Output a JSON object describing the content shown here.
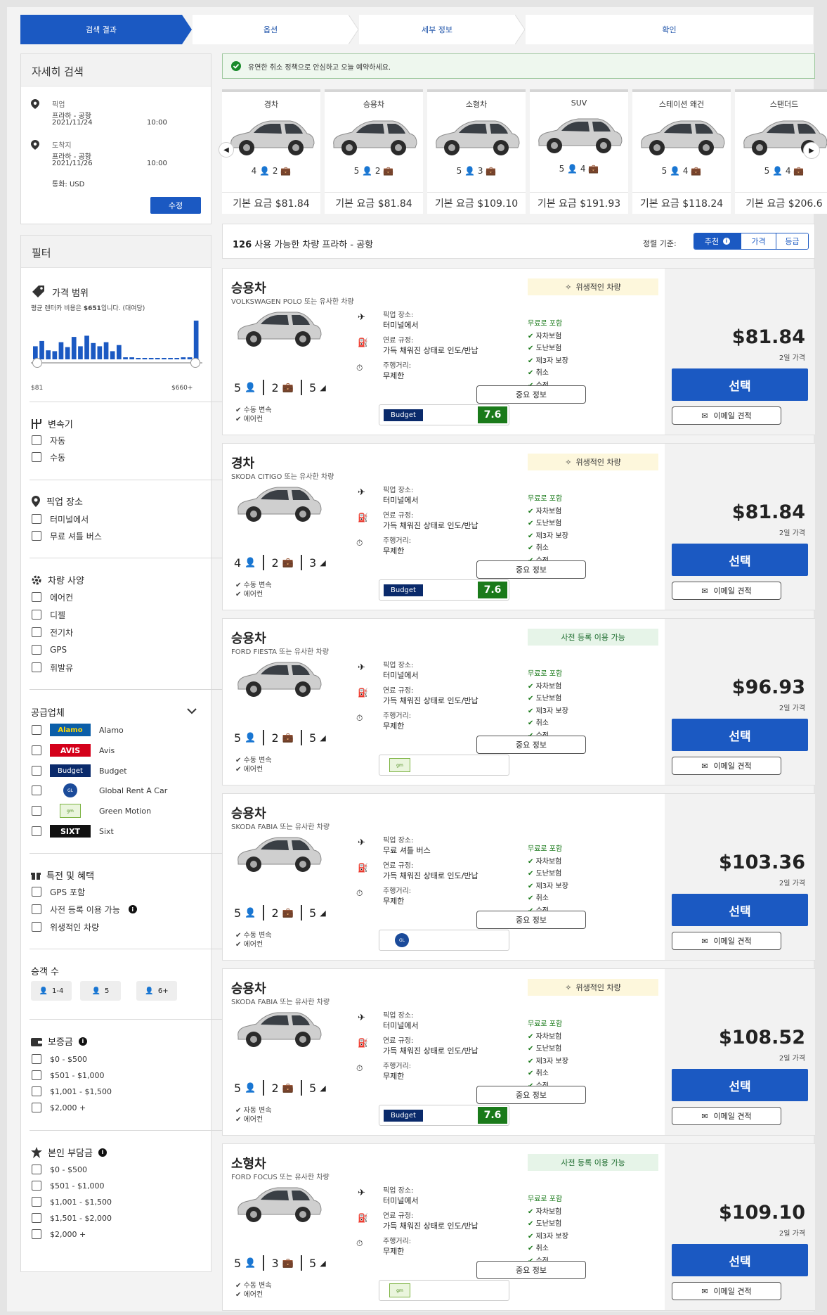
{
  "steps": [
    "검색 결과",
    "옵션",
    "세부 정보",
    "확인"
  ],
  "search": {
    "title": "자세히 검색",
    "pickup_label": "픽업",
    "pickup_place": "프라하 - 공항",
    "pickup_date": "2021/11/24",
    "pickup_time": "10:00",
    "dropoff_label": "도착지",
    "dropoff_place": "프라하 - 공항",
    "dropoff_date": "2021/11/26",
    "dropoff_time": "10:00",
    "currency": "통화: USD",
    "edit_label": "수정"
  },
  "filters": {
    "title": "필터",
    "price": {
      "title": "가격 범위",
      "note_prefix": "평균 렌터카 비용은 ",
      "note_value": "$651",
      "note_suffix": "입니다. (대여당)",
      "min_label": "$81",
      "max_label": "$660+",
      "histogram": [
        0.32,
        0.45,
        0.22,
        0.2,
        0.42,
        0.3,
        0.55,
        0.32,
        0.58,
        0.4,
        0.32,
        0.42,
        0.2,
        0.35,
        0.05,
        0.05,
        0.02,
        0.02,
        0.02,
        0.02,
        0.02,
        0.02,
        0.02,
        0.05,
        0.05,
        0.95
      ]
    },
    "transmission": {
      "title": "변속기",
      "options": [
        "자동",
        "수동"
      ]
    },
    "pickup": {
      "title": "픽업 장소",
      "options": [
        "터미널에서",
        "무료 셔틀 버스"
      ]
    },
    "specs": {
      "title": "차량 사양",
      "options": [
        "에어컨",
        "디젤",
        "전기차",
        "GPS",
        "휘발유"
      ]
    },
    "suppliers": {
      "title": "공급업체",
      "options": [
        "Alamo",
        "Avis",
        "Budget",
        "Global Rent A Car",
        "Green Motion",
        "Sixt"
      ]
    },
    "deals": {
      "title": "특전 및 혜택",
      "options": [
        "GPS 포함",
        "사전 등록 이용 가능",
        "위생적인 차량"
      ]
    },
    "passengers": {
      "title": "승객 수",
      "options": [
        "1-4",
        "5",
        "6+"
      ]
    },
    "deposit": {
      "title": "보증금",
      "options": [
        "$0 - $500",
        "$501 - $1,000",
        "$1,001 - $1,500",
        "$2,000 +"
      ]
    },
    "excess": {
      "title": "본인 부담금",
      "options": [
        "$0 - $500",
        "$501 - $1,000",
        "$1,001 - $1,500",
        "$1,501 - $2,000",
        "$2,000 +"
      ]
    }
  },
  "banner": "유연한 취소 정책으로 안심하고 오늘 예약하세요.",
  "categories": [
    {
      "name": "경차",
      "seats": "4",
      "bags": "2",
      "price": "기본 요금 $81.84"
    },
    {
      "name": "승용차",
      "seats": "5",
      "bags": "2",
      "price": "기본 요금 $81.84"
    },
    {
      "name": "소형차",
      "seats": "5",
      "bags": "3",
      "price": "기본 요금 $109.10"
    },
    {
      "name": "SUV",
      "seats": "5",
      "bags": "4",
      "price": "기본 요금 $191.93"
    },
    {
      "name": "스테이션 왜건",
      "seats": "5",
      "bags": "4",
      "price": "기본 요금 $118.24"
    },
    {
      "name": "스탠더드",
      "seats": "5",
      "bags": "4",
      "price": "기본 요금 $206.6"
    }
  ],
  "results_bar": {
    "count": "126",
    "text": " 사용 가능한 차량 ",
    "location": "프라하 - 공항",
    "sort_label": "정렬 기준:",
    "sort_options": [
      "추천",
      "가격",
      "등급"
    ]
  },
  "labels": {
    "pickup_place": "픽업 장소:",
    "fuel": "연료 규정:",
    "fuel_value": "가득 채워진 상태로 인도/반납",
    "mileage": "주행거리:",
    "mileage_value": "무제한",
    "included": "무료로 포함",
    "included_items": [
      "자차보험",
      "도난보험",
      "제3자 보장",
      "취소",
      "수정"
    ],
    "days": "2일 가격",
    "select": "선택",
    "details": "중요 정보",
    "email": "이메일 견적",
    "aircon": "에어컨"
  },
  "results": [
    {
      "category": "승용차",
      "model": "VOLKSWAGEN POLO 또는 유사한 차량",
      "seats": "5",
      "bags": "2",
      "doors": "5",
      "transmission": "수동 변속",
      "pickup": "터미널에서",
      "vendor": "Budget",
      "score": "7.6",
      "badge": "위생적인 차량",
      "badge_type": "hyg",
      "price": "$81.84"
    },
    {
      "category": "경차",
      "model": "SKODA CITIGO 또는 유사한 차량",
      "seats": "4",
      "bags": "2",
      "doors": "3",
      "transmission": "수동 변속",
      "pickup": "터미널에서",
      "vendor": "Budget",
      "score": "7.6",
      "badge": "위생적인 차량",
      "badge_type": "hyg",
      "price": "$81.84"
    },
    {
      "category": "승용차",
      "model": "FORD FIESTA 또는 유사한 차량",
      "seats": "5",
      "bags": "2",
      "doors": "5",
      "transmission": "수동 변속",
      "pickup": "터미널에서",
      "vendor": "Green Motion",
      "score": "",
      "badge": "사전 등록 이용 가능",
      "badge_type": "pre",
      "price": "$96.93"
    },
    {
      "category": "승용차",
      "model": "SKODA FABIA 또는 유사한 차량",
      "seats": "5",
      "bags": "2",
      "doors": "5",
      "transmission": "수동 변속",
      "pickup": "무료 셔틀 버스",
      "vendor": "Global",
      "score": "",
      "badge": "",
      "badge_type": "",
      "price": "$103.36"
    },
    {
      "category": "승용차",
      "model": "SKODA FABIA 또는 유사한 차량",
      "seats": "5",
      "bags": "2",
      "doors": "5",
      "transmission": "자동 변속",
      "pickup": "터미널에서",
      "vendor": "Budget",
      "score": "7.6",
      "badge": "위생적인 차량",
      "badge_type": "hyg",
      "price": "$108.52"
    },
    {
      "category": "소형차",
      "model": "FORD FOCUS 또는 유사한 차량",
      "seats": "5",
      "bags": "3",
      "doors": "5",
      "transmission": "수동 변속",
      "pickup": "터미널에서",
      "vendor": "Green Motion",
      "score": "",
      "badge": "사전 등록 이용 가능",
      "badge_type": "pre",
      "price": "$109.10"
    }
  ]
}
